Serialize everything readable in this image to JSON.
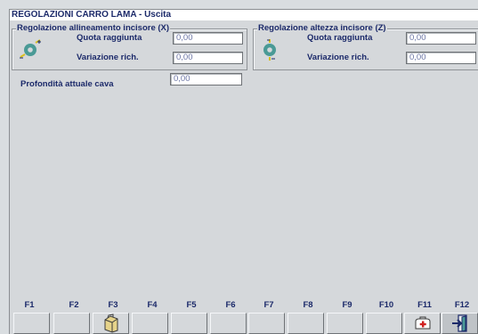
{
  "window": {
    "title": "REGOLAZIONI CARRO LAMA - Uscita"
  },
  "group_x": {
    "title": "Regolazione allineamento incisore (X)",
    "quota_label": "Quota raggiunta",
    "quota_value": "0,00",
    "variazione_label": "Variazione rich.",
    "variazione_value": "0,00",
    "icon": "blade-align-icon"
  },
  "group_z": {
    "title": "Regolazione altezza incisore (Z)",
    "quota_label": "Quota raggiunta",
    "quota_value": "0,00",
    "variazione_label": "Variazione rich.",
    "variazione_value": "0,00",
    "icon": "blade-height-icon"
  },
  "profondita": {
    "label": "Profondità attuale cava",
    "value": "0,00"
  },
  "fkeys": [
    {
      "label": "F1"
    },
    {
      "label": "F2"
    },
    {
      "label": "F3",
      "icon": "folder-icon"
    },
    {
      "label": "F4"
    },
    {
      "label": "F5"
    },
    {
      "label": "F6"
    },
    {
      "label": "F7"
    },
    {
      "label": "F8"
    },
    {
      "label": "F9"
    },
    {
      "label": "F10"
    },
    {
      "label": "F11",
      "icon": "first-aid-icon"
    },
    {
      "label": "F12",
      "icon": "exit-icon"
    }
  ],
  "colors": {
    "label_text": "#1c2a6a",
    "panel": "#d5d8db",
    "field_text": "#6a74a4"
  }
}
